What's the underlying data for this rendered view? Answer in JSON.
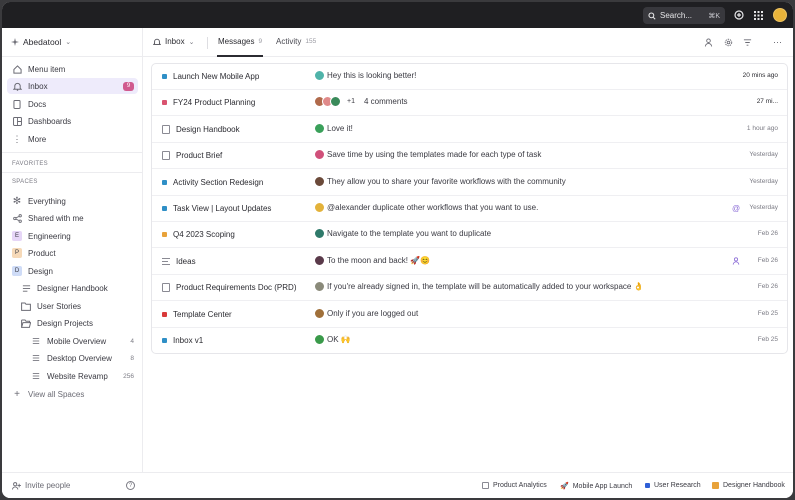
{
  "titlebar": {
    "search_label": "Search...",
    "search_shortcut": "⌘K",
    "icons": [
      "search-icon",
      "plus-circle-icon",
      "grid-icon",
      "user-avatar"
    ]
  },
  "sidebar": {
    "workspace_name": "Abedatool",
    "nav": [
      {
        "label": "Menu item",
        "icon": "home-icon"
      },
      {
        "label": "Inbox",
        "icon": "bell-icon",
        "badge": "9",
        "active": true
      },
      {
        "label": "Docs",
        "icon": "doc-icon"
      },
      {
        "label": "Dashboards",
        "icon": "dashboard-icon"
      },
      {
        "label": "More",
        "icon": "more-vertical-icon"
      }
    ],
    "favorites_heading": "FAVORITES",
    "spaces_heading": "SPACES",
    "spaces": [
      {
        "label": "Everything",
        "icon": "asterisk-icon"
      },
      {
        "label": "Shared with me",
        "icon": "share-icon"
      },
      {
        "label": "Engineering",
        "tile": "E",
        "color": "#e6d6f7"
      },
      {
        "label": "Product",
        "tile": "P",
        "color": "#f6d9b8"
      },
      {
        "label": "Design",
        "tile": "D",
        "color": "#cfdcf7"
      }
    ],
    "design_children": [
      {
        "label": "Designer Handbook",
        "icon": "doc-icon"
      },
      {
        "label": "User Stories",
        "icon": "folder-icon"
      },
      {
        "label": "Design  Projects",
        "icon": "folder-open-icon"
      }
    ],
    "project_lists": [
      {
        "label": "Mobile Overview",
        "count": "4"
      },
      {
        "label": "Desktop Overview",
        "count": "8"
      },
      {
        "label": "Website Revamp",
        "count": "256"
      }
    ],
    "view_all": "View all Spaces",
    "invite": "Invite people",
    "help": "?"
  },
  "header": {
    "inbox_label": "Inbox",
    "tabs": [
      {
        "label": "Messages",
        "count": "9"
      },
      {
        "label": "Activity",
        "count": "155"
      }
    ]
  },
  "messages": [
    {
      "name": "Launch New Mobile App",
      "marker": "square",
      "marker_color": "#2f8fc6",
      "avatars": [
        "#4fb3a9"
      ],
      "text": "Hey this is looking better!",
      "time": "20 mins ago",
      "time_dark": true
    },
    {
      "name": "FY24 Product Planning",
      "marker": "square",
      "marker_color": "#d9536f",
      "avatars": [
        "#b06a4b",
        "#e08a8a",
        "#3a8a5a"
      ],
      "extra": "+1",
      "text": "4 comments",
      "time": "27 mi...",
      "time_dark": true
    },
    {
      "name": "Design Handbook",
      "marker": "doc",
      "avatars": [
        "#3aa05a"
      ],
      "text": "Love it!",
      "time": "1 hour ago"
    },
    {
      "name": "Product Brief",
      "marker": "doc",
      "avatars": [
        "#d0507a"
      ],
      "text": "Save time by using the templates made for each type of task",
      "time": "Yesterday"
    },
    {
      "name": "Activity Section Redesign",
      "marker": "square",
      "marker_color": "#2f8fc6",
      "avatars": [
        "#6b4a3a"
      ],
      "text": "They allow you to share your favorite workflows with the community",
      "time": "Yesterday"
    },
    {
      "name": "Task View | Layout Updates",
      "marker": "square",
      "marker_color": "#2f8fc6",
      "avatars": [
        "#e3b23a"
      ],
      "text": "@alexander duplicate other workflows that you want to use.",
      "time": "Yesterday",
      "row_icon": "at-icon"
    },
    {
      "name": "Q4 2023 Scoping",
      "marker": "square",
      "marker_color": "#e8a23a",
      "avatars": [
        "#2f7a6a"
      ],
      "text": "Navigate to the template you want to duplicate",
      "time": "Feb 26"
    },
    {
      "name": "Ideas",
      "marker": "lines",
      "avatars": [
        "#5a3a4a"
      ],
      "text": "To the moon and back! 🚀😊",
      "time": "Feb 26",
      "row_icon": "person-icon"
    },
    {
      "name": "Product Requirements Doc (PRD)",
      "marker": "doc",
      "avatars": [
        "#8a8a7a"
      ],
      "text": "If you're already signed in, the template will be automatically added to your workspace 👌",
      "time": "Feb 26"
    },
    {
      "name": "Template Center",
      "marker": "square",
      "marker_color": "#d93a3a",
      "avatars": [
        "#a0703a"
      ],
      "text": "Only if you are logged out",
      "time": "Feb 25"
    },
    {
      "name": "Inbox v1",
      "marker": "square",
      "marker_color": "#2f8fc6",
      "avatars": [
        "#3a9a4a"
      ],
      "text": "OK 🙌",
      "time": "Feb 25"
    }
  ],
  "bottombar": {
    "chips": [
      {
        "label": "Product Analytics",
        "icon": "doc-icon",
        "color": "#8a8a93"
      },
      {
        "label": "Mobile App Launch",
        "icon": "rocket-icon",
        "color": "#e85a3a"
      },
      {
        "label": "User Research",
        "icon": "square-icon",
        "color": "#2f5fd6"
      },
      {
        "label": "Designer Handbook",
        "icon": "doc-icon",
        "color": "#e8a23a"
      }
    ]
  }
}
